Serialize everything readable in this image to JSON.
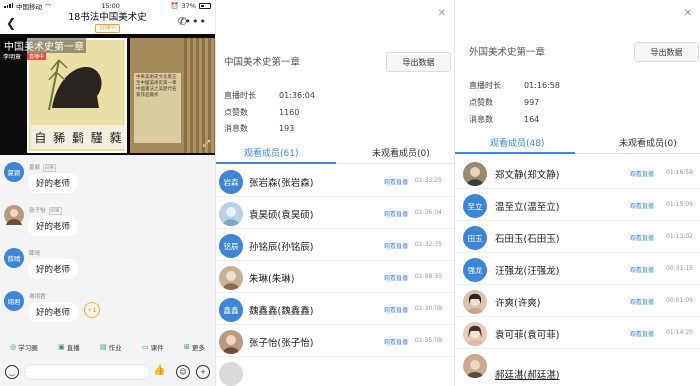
{
  "phone": {
    "status": {
      "carrier": "中国移动",
      "time": "15:00",
      "battery": "37%"
    },
    "nav": {
      "title": "18书法中国美术史",
      "badge": "直播中"
    },
    "video": {
      "title": "中国美术史第一章",
      "presenter": "李明章",
      "live_tag": "直播中",
      "calligraphy": [
        "自",
        "豨",
        "鬎",
        "騹",
        "蕤"
      ],
      "doc_text": "中華美術史文化意正至中國美術史第一章中國書法之美歷代名家作品賞析"
    },
    "messages": [
      {
        "avatar": "夏颖",
        "sender": "夏颖",
        "role": "同事",
        "text": "好的老师"
      },
      {
        "avatar": "",
        "sender": "张子怡",
        "role": "同事",
        "text": "好的老师"
      },
      {
        "avatar": "薛晴",
        "sender": "薛晴",
        "role": "",
        "text": "好的老师"
      },
      {
        "avatar": "翊君",
        "sender": "谢翊君",
        "role": "",
        "text": "好的老师",
        "plus": "+1"
      }
    ],
    "tabs": [
      "学习圈",
      "直播",
      "作业",
      "课件",
      "更多"
    ]
  },
  "panels": [
    {
      "chapter": "中国美术史第一章",
      "export": "导出数据",
      "stats": [
        {
          "k": "直播时长",
          "v": "01:36:04"
        },
        {
          "k": "点赞数",
          "v": "1160"
        },
        {
          "k": "消息数",
          "v": "193"
        }
      ],
      "tab_watched": "观看成员(61)",
      "tab_unwatched": "未观看成员(0)",
      "members": [
        {
          "av": "岩森",
          "name": "张岩森(张岩森)",
          "link": "观看直播",
          "time": "01:33:25"
        },
        {
          "av": "",
          "name": "袁昊硕(袁昊硕)",
          "link": "观看直播",
          "time": "01:36:04"
        },
        {
          "av": "铭辰",
          "name": "孙铭辰(孙铭辰)",
          "link": "观看直播",
          "time": "01:32:35"
        },
        {
          "av": "",
          "name": "朱琳(朱琳)",
          "link": "观看直播",
          "time": "01:08:30"
        },
        {
          "av": "鑫鑫",
          "name": "魏鑫鑫(魏鑫鑫)",
          "link": "观看直播",
          "time": "01:30:08"
        },
        {
          "av": "",
          "name": "张子怡(张子怡)",
          "link": "观看直播",
          "time": "01:35:08"
        }
      ]
    },
    {
      "chapter": "外国美术史第一章",
      "export": "导出数据",
      "stats": [
        {
          "k": "直播时长",
          "v": "01:16:58"
        },
        {
          "k": "点赞数",
          "v": "997"
        },
        {
          "k": "消息数",
          "v": "164"
        }
      ],
      "tab_watched": "观看成员(48)",
      "tab_unwatched": "未观看成员(0)",
      "members": [
        {
          "av": "",
          "name": "郑文静(郑文静)",
          "link": "观看直播",
          "time": "01:16:58"
        },
        {
          "av": "至立",
          "name": "温至立(温至立)",
          "link": "观看直播",
          "time": "01:15:09"
        },
        {
          "av": "田玉",
          "name": "石田玉(石田玉)",
          "link": "观看直播",
          "time": "01:13:02"
        },
        {
          "av": "强龙",
          "name": "汪强龙(汪强龙)",
          "link": "观看直播",
          "time": "00:31:15"
        },
        {
          "av": "",
          "name": "许爽(许爽)",
          "link": "观看直播",
          "time": "00:01:09"
        },
        {
          "av": "",
          "name": "袁可菲(袁可菲)",
          "link": "观看直播",
          "time": "01:14:20"
        },
        {
          "av": "",
          "name": "郝廷湛(郝廷湛)",
          "link": "观看直播",
          "time": "01:13:09"
        }
      ]
    }
  ],
  "colors": {
    "accent": "#3e8ae0",
    "avatar_blue": "#3d86d6",
    "plus_orange": "#f2b33d",
    "live_red": "#e34b3c"
  }
}
